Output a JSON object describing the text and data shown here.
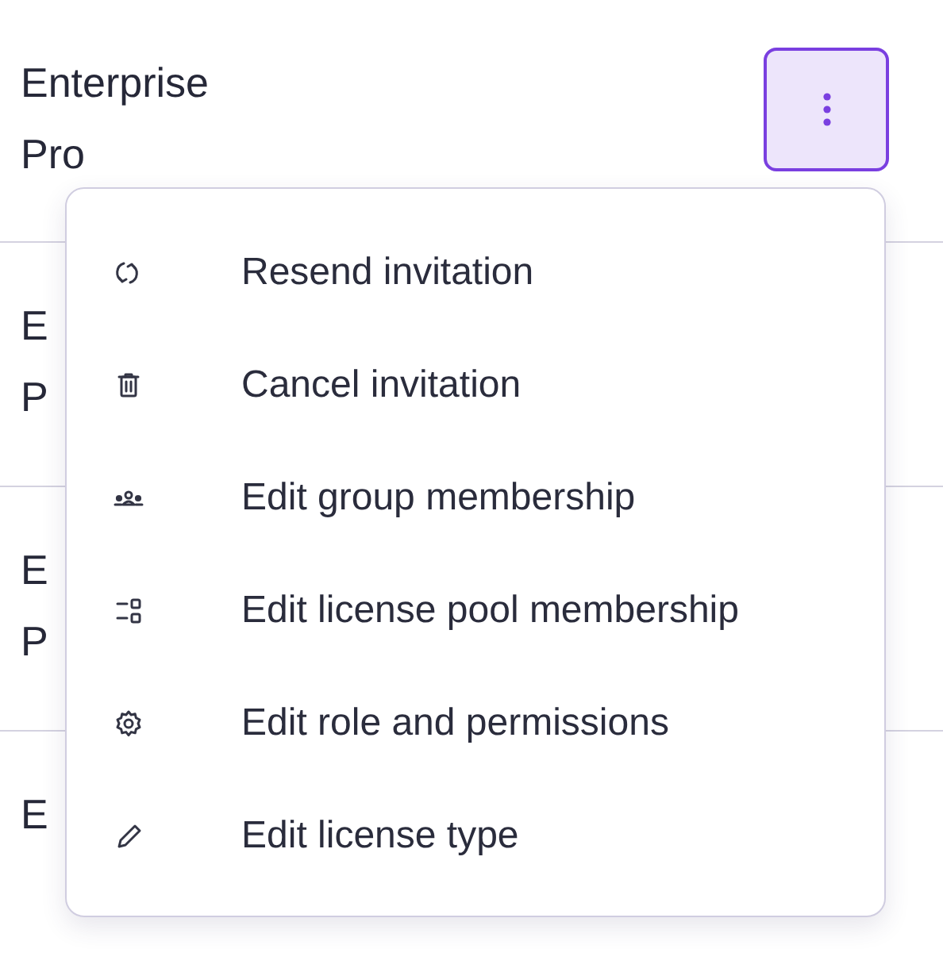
{
  "rows": [
    {
      "lines": [
        "Enterprise",
        "Pro"
      ]
    },
    {
      "lines": [
        "E",
        "P"
      ]
    },
    {
      "lines": [
        "E",
        "P"
      ]
    },
    {
      "lines": [
        "E"
      ]
    }
  ],
  "menu_button": {
    "expanded": true
  },
  "menu": [
    {
      "kind": "resend",
      "label": "Resend invitation"
    },
    {
      "kind": "trash",
      "label": "Cancel invitation"
    },
    {
      "kind": "group",
      "label": "Edit group membership"
    },
    {
      "kind": "pool",
      "label": "Edit license pool membership"
    },
    {
      "kind": "gear",
      "label": "Edit role and permissions"
    },
    {
      "kind": "pencil",
      "label": "Edit license type"
    }
  ]
}
